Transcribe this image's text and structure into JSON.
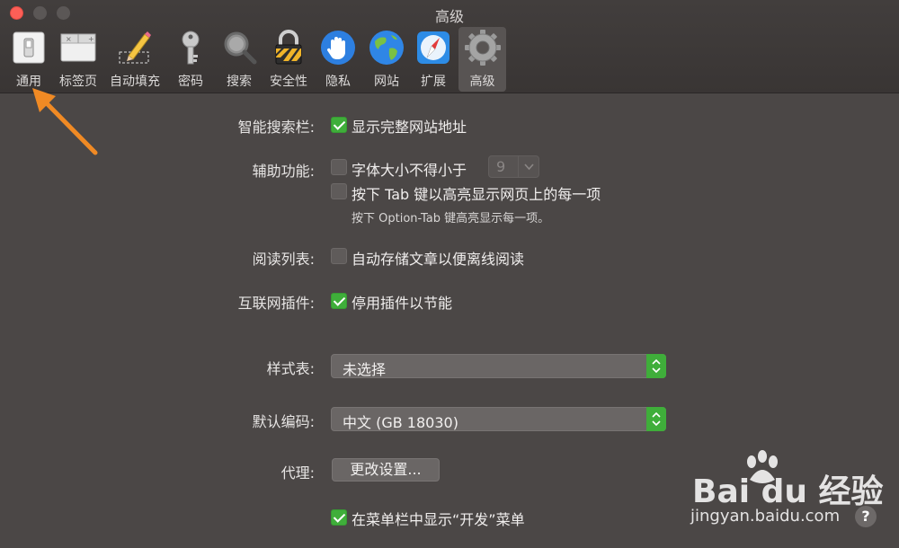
{
  "window": {
    "title": "高级"
  },
  "toolbar": {
    "tabs": [
      {
        "label": "通用",
        "icon": "general-switch-icon"
      },
      {
        "label": "标签页",
        "icon": "tabs-icon"
      },
      {
        "label": "自动填充",
        "icon": "pencil-icon"
      },
      {
        "label": "密码",
        "icon": "key-icon"
      },
      {
        "label": "搜索",
        "icon": "magnifier-icon"
      },
      {
        "label": "安全性",
        "icon": "lock-icon"
      },
      {
        "label": "隐私",
        "icon": "hand-icon"
      },
      {
        "label": "网站",
        "icon": "globe-icon"
      },
      {
        "label": "扩展",
        "icon": "compass-icon"
      },
      {
        "label": "高级",
        "icon": "gear-icon"
      }
    ],
    "active_tab": "高级"
  },
  "settings": {
    "smart_search": {
      "label": "智能搜索栏:",
      "option": "显示完整网站地址",
      "checked": true
    },
    "accessibility": {
      "label": "辅助功能:",
      "min_font_option": "字体大小不得小于",
      "min_font_checked": false,
      "min_font_value": "9",
      "tab_option": "按下 Tab 键以高亮显示网页上的每一项",
      "tab_checked": false,
      "tab_hint": "按下 Option-Tab 键高亮显示每一项。"
    },
    "reading_list": {
      "label": "阅读列表:",
      "option": "自动存储文章以便离线阅读",
      "checked": false
    },
    "plugins": {
      "label": "互联网插件:",
      "option": "停用插件以节能",
      "checked": true
    },
    "stylesheet": {
      "label": "样式表:",
      "value": "未选择"
    },
    "encoding": {
      "label": "默认编码:",
      "value": "中文 (GB 18030)"
    },
    "proxy": {
      "label": "代理:",
      "button": "更改设置..."
    },
    "develop_menu": {
      "option": "在菜单栏中显示“开发”菜单",
      "checked": true
    }
  },
  "watermark": {
    "brand": "Bai du 经验",
    "url": "jingyan.baidu.com"
  },
  "help": {
    "label": "?"
  },
  "colors": {
    "accent_green": "#3fae3a",
    "annotation_arrow": "#f08a24",
    "close_red": "#fc5f57"
  }
}
